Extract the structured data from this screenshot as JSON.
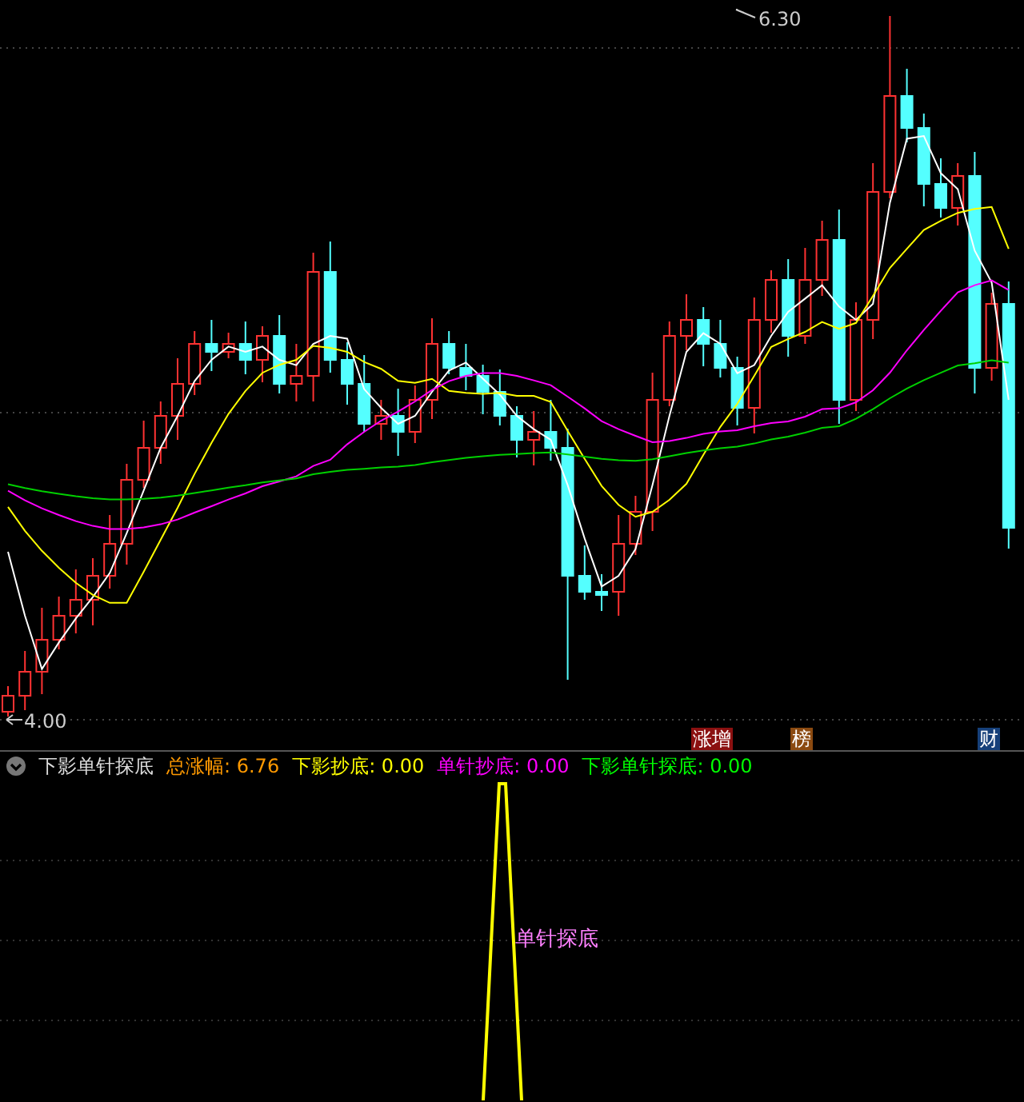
{
  "price_chart": {
    "high_label": "6.30",
    "low_label": "4.00",
    "tags": [
      {
        "text": "涨增",
        "color": "#8b1010"
      },
      {
        "text": "榜",
        "color": "#8b4a10"
      },
      {
        "text": "财",
        "color": "#16407a"
      }
    ]
  },
  "indicator": {
    "name": "下影单针探底",
    "values": [
      {
        "label": "总涨幅:",
        "value": "6.76",
        "color": "#ff9900"
      },
      {
        "label": "下影抄底:",
        "value": "0.00",
        "color": "#ffff00"
      },
      {
        "label": "单针抄底:",
        "value": "0.00",
        "color": "#ff00ff"
      },
      {
        "label": "下影单针探底:",
        "value": "0.00",
        "color": "#00ff00"
      }
    ]
  },
  "signal_label": "单针探底"
}
